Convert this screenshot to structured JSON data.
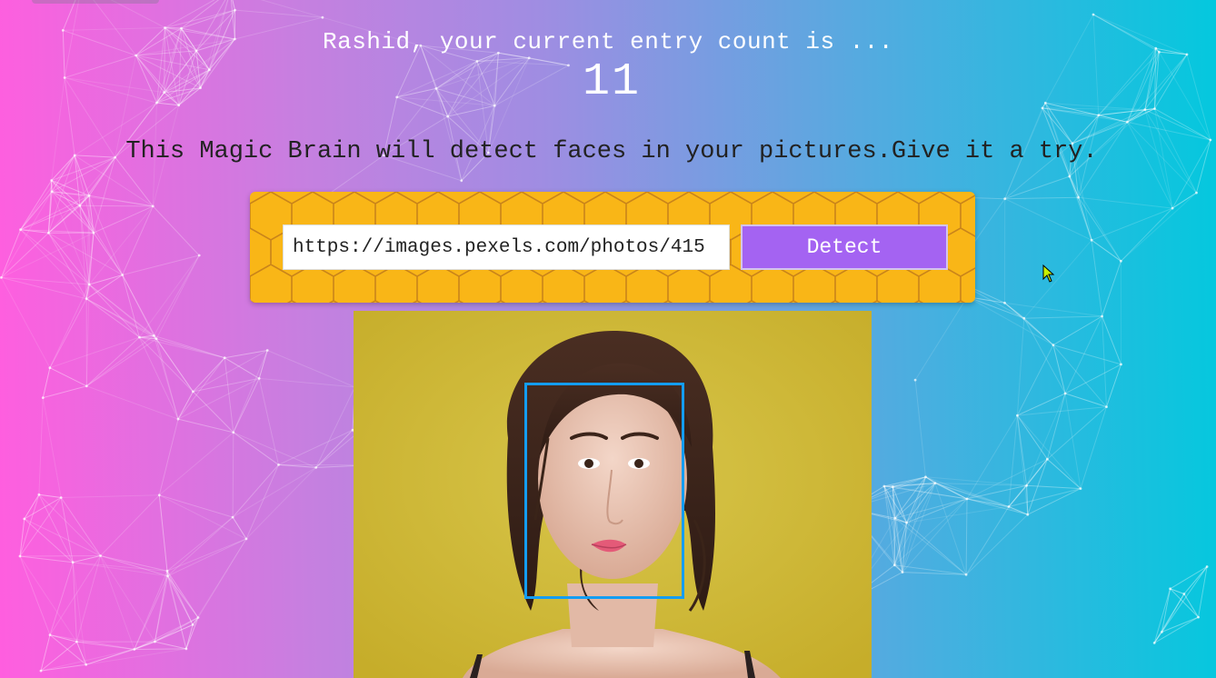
{
  "rank": {
    "entry_text": "Rashid, your current entry count is ...",
    "entry_count": "11"
  },
  "intro": {
    "text": "This Magic Brain will detect faces in your pictures.Give it a try."
  },
  "form": {
    "url_value": "https://images.pexels.com/photos/415",
    "detect_label": "Detect"
  },
  "colors": {
    "gradient_left": "#ff5edf",
    "gradient_right": "#04c8de",
    "panel": "#f9b617",
    "button": "#a463f2",
    "face_box": "#149df2",
    "photo_background": "#cdb62f"
  },
  "icons": {
    "cursor": "mouse-pointer-icon",
    "background": "particle-network"
  }
}
